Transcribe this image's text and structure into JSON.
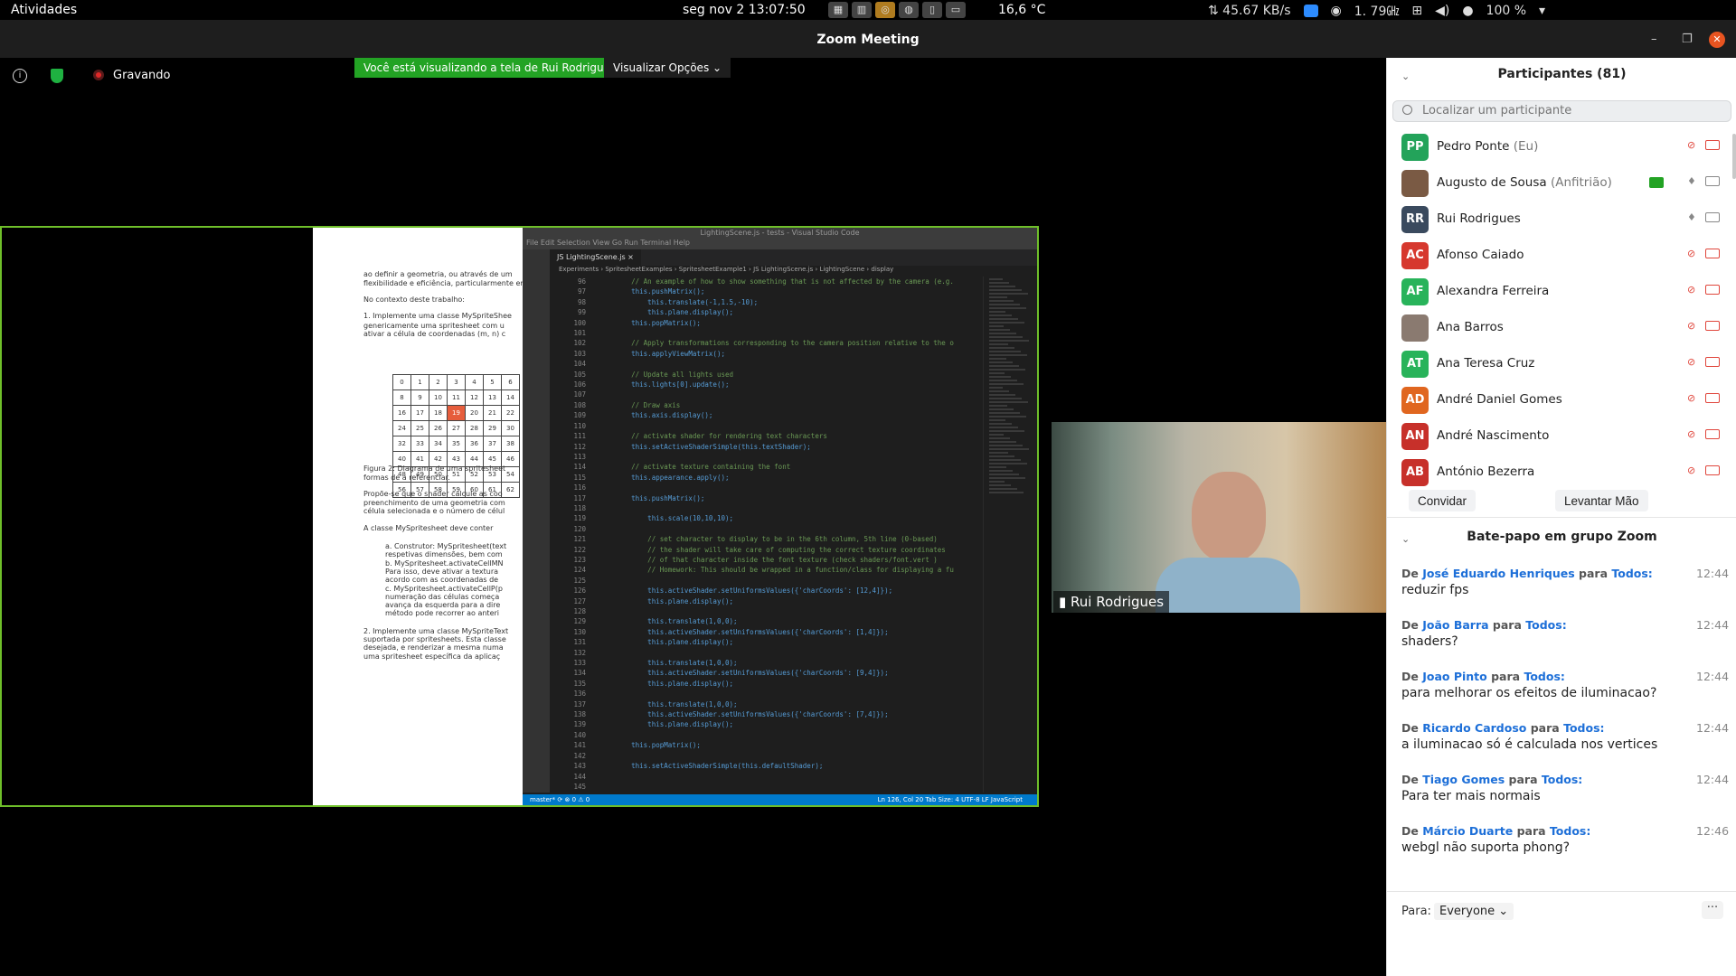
{
  "topbar": {
    "activities": "Atividades",
    "clock": "seg nov 2  13:07:50",
    "weather": "16,6 °C",
    "net": "⇅ 45.67 KB/s",
    "scale": "1. 79㎓",
    "battery": "100 %",
    "tray_icons": [
      "cpu-icon",
      "memory-icon",
      "chip-icon",
      "globe-icon",
      "clipboard-icon",
      "monitor-icon"
    ]
  },
  "window": {
    "title": "Zoom Meeting"
  },
  "meeting": {
    "recording_label": "Gravando",
    "banner": "Você está visualizando a tela de Rui Rodrigues",
    "view_options": "Visualizar Opções"
  },
  "shared": {
    "doc_lines": [
      "ao definir a geometria, ou através de um",
      "flexibilidade e eficiência, particularmente em c",
      "No contexto deste trabalho:",
      "1.   Implemente uma classe MySpriteShee",
      "genericamente uma spritesheet com u",
      "ativar a célula de coordenadas (m, n) c",
      "Figura 2: Diagrama de uma spritesheet",
      "formas de a referenciar.",
      "Propõe-se que o shader calcule as coo",
      "preenchimento de uma geometria com",
      "célula selecionada e o número de célul",
      "A classe  MySpritesheet deve conter",
      "a.  Construtor: MySpritesheet(text",
      "respetivas dimensões, bem com",
      "b.  MySpritesheet.activateCellMN",
      "Para isso, deve ativar a textura",
      "acordo com as coordenadas de",
      "c.  MySpritesheet.activateCellP(p",
      "numeração das células começa",
      "avança da esquerda para a dire",
      "método pode recorrer ao anteri",
      "2.  Implemente uma classe MySpriteText",
      "suportada por spritesheets. Esta classe",
      "desejada, e renderizar a mesma numa",
      "uma spritesheet específica da aplicaç"
    ],
    "grid_rows": [
      [
        "0",
        "1",
        "2",
        "3",
        "4",
        "5",
        "6"
      ],
      [
        "8",
        "9",
        "10",
        "11",
        "12",
        "13",
        "14"
      ],
      [
        "16",
        "17",
        "18",
        "19",
        "20",
        "21",
        "22"
      ],
      [
        "24",
        "25",
        "26",
        "27",
        "28",
        "29",
        "30"
      ],
      [
        "32",
        "33",
        "34",
        "35",
        "36",
        "37",
        "38"
      ],
      [
        "40",
        "41",
        "42",
        "43",
        "44",
        "45",
        "46"
      ],
      [
        "48",
        "49",
        "50",
        "51",
        "52",
        "53",
        "54"
      ],
      [
        "56",
        "57",
        "58",
        "59",
        "60",
        "61",
        "62"
      ]
    ],
    "grid_highlight": "19",
    "vscode_title": "LightingScene.js - tests - Visual Studio Code",
    "vscode_menu": "File   Edit   Selection   View   Go   Run   Terminal   Help",
    "tab": "JS  LightingScene.js  ×",
    "breadcrumb": "Experiments  ›  SpritesheetExamples  ›  SpritesheetExample1  ›  JS LightingScene.js  ›  LightingScene  ›  display",
    "status_left": "master*   ⟳   ⊗ 0 ⚠ 0",
    "status_right": "Ln 126, Col 20    Tab Size: 4    UTF-8    LF    JavaScript",
    "code": [
      [
        "96",
        "        // An example of how to show something that is not affected by the camera (e.g."
      ],
      [
        "97",
        "        this.pushMatrix();"
      ],
      [
        "98",
        "            this.translate(-1,1.5,-10);"
      ],
      [
        "99",
        "            this.plane.display();"
      ],
      [
        "100",
        "        this.popMatrix();"
      ],
      [
        "101",
        ""
      ],
      [
        "102",
        "        // Apply transformations corresponding to the camera position relative to the o"
      ],
      [
        "103",
        "        this.applyViewMatrix();"
      ],
      [
        "104",
        ""
      ],
      [
        "105",
        "        // Update all lights used"
      ],
      [
        "106",
        "        this.lights[0].update();"
      ],
      [
        "107",
        ""
      ],
      [
        "108",
        "        // Draw axis"
      ],
      [
        "109",
        "        this.axis.display();"
      ],
      [
        "110",
        ""
      ],
      [
        "111",
        "        // activate shader for rendering text characters"
      ],
      [
        "112",
        "        this.setActiveShaderSimple(this.textShader);"
      ],
      [
        "113",
        ""
      ],
      [
        "114",
        "        // activate texture containing the font"
      ],
      [
        "115",
        "        this.appearance.apply();"
      ],
      [
        "116",
        ""
      ],
      [
        "117",
        "        this.pushMatrix();"
      ],
      [
        "118",
        ""
      ],
      [
        "119",
        "            this.scale(10,10,10);"
      ],
      [
        "120",
        ""
      ],
      [
        "121",
        "            // set character to display to be in the 6th column, 5th line (0-based)"
      ],
      [
        "122",
        "            // the shader will take care of computing the correct texture coordinates"
      ],
      [
        "123",
        "            // of that character inside the font texture (check shaders/font.vert )"
      ],
      [
        "124",
        "            // Homework: This should be wrapped in a function/class for displaying a fu"
      ],
      [
        "125",
        ""
      ],
      [
        "126",
        "            this.activeShader.setUniformsValues({'charCoords': [12,4]});"
      ],
      [
        "127",
        "            this.plane.display();"
      ],
      [
        "128",
        ""
      ],
      [
        "129",
        "            this.translate(1,0,0);"
      ],
      [
        "130",
        "            this.activeShader.setUniformsValues({'charCoords': [1,4]});"
      ],
      [
        "131",
        "            this.plane.display();"
      ],
      [
        "132",
        ""
      ],
      [
        "133",
        "            this.translate(1,0,0);"
      ],
      [
        "134",
        "            this.activeShader.setUniformsValues({'charCoords': [9,4]});"
      ],
      [
        "135",
        "            this.plane.display();"
      ],
      [
        "136",
        ""
      ],
      [
        "137",
        "            this.translate(1,0,0);"
      ],
      [
        "138",
        "            this.activeShader.setUniformsValues({'charCoords': [7,4]});"
      ],
      [
        "139",
        "            this.plane.display();"
      ],
      [
        "140",
        ""
      ],
      [
        "141",
        "        this.popMatrix();"
      ],
      [
        "142",
        ""
      ],
      [
        "143",
        "        this.setActiveShaderSimple(this.defaultShader);"
      ],
      [
        "144",
        ""
      ],
      [
        "145",
        ""
      ]
    ]
  },
  "video": {
    "name": "Rui Rodrigues"
  },
  "participants": {
    "title": "Participantes (81)",
    "search_placeholder": "Localizar um participante",
    "list": [
      {
        "initials": "PP",
        "name": "Pedro Ponte",
        "role": "(Eu)",
        "color": "#23a35a",
        "muted": true
      },
      {
        "initials": "",
        "name": "Augusto de Sousa",
        "role": "(Anfitrião)",
        "color": "#7a5a44",
        "muted": false
      },
      {
        "initials": "RR",
        "name": "Rui Rodrigues",
        "role": "",
        "color": "#3a4a5e",
        "muted": false
      },
      {
        "initials": "AC",
        "name": "Afonso Caiado",
        "role": "",
        "color": "#d6382e",
        "muted": true
      },
      {
        "initials": "AF",
        "name": "Alexandra Ferreira",
        "role": "",
        "color": "#28b35a",
        "muted": true
      },
      {
        "initials": "",
        "name": "Ana Barros",
        "role": "",
        "color": "#8a7a70",
        "muted": true
      },
      {
        "initials": "AT",
        "name": "Ana Teresa Cruz",
        "role": "",
        "color": "#28b35a",
        "muted": true
      },
      {
        "initials": "AD",
        "name": "André Daniel Gomes",
        "role": "",
        "color": "#e0661f",
        "muted": true
      },
      {
        "initials": "AN",
        "name": "André Nascimento",
        "role": "",
        "color": "#c7302a",
        "muted": true
      },
      {
        "initials": "AB",
        "name": "António Bezerra",
        "role": "",
        "color": "#c7302a",
        "muted": true
      }
    ],
    "invite": "Convidar",
    "raise_hand": "Levantar Mão"
  },
  "chat": {
    "title": "Bate-papo em grupo Zoom",
    "from_word": "De",
    "to_word": "para",
    "messages": [
      {
        "from": "José Eduardo Henriques",
        "to": "Todos:",
        "time": "12:44",
        "text": "reduzir fps"
      },
      {
        "from": "João Barra",
        "to": "Todos:",
        "time": "12:44",
        "text": "shaders?"
      },
      {
        "from": "Joao Pinto",
        "to": "Todos:",
        "time": "12:44",
        "text": "para melhorar os efeitos de iluminacao?"
      },
      {
        "from": "Ricardo Cardoso",
        "to": "Todos:",
        "time": "12:44",
        "text": "a iluminacao só é calculada nos vertices"
      },
      {
        "from": "Tiago Gomes",
        "to": "Todos:",
        "time": "12:44",
        "text": "Para ter mais normais"
      },
      {
        "from": "Márcio Duarte",
        "to": "Todos:",
        "time": "12:46",
        "text": "webgl não suporta phong?"
      }
    ],
    "to_label": "Para:",
    "to_value": "Everyone ⌄",
    "more": "···"
  }
}
